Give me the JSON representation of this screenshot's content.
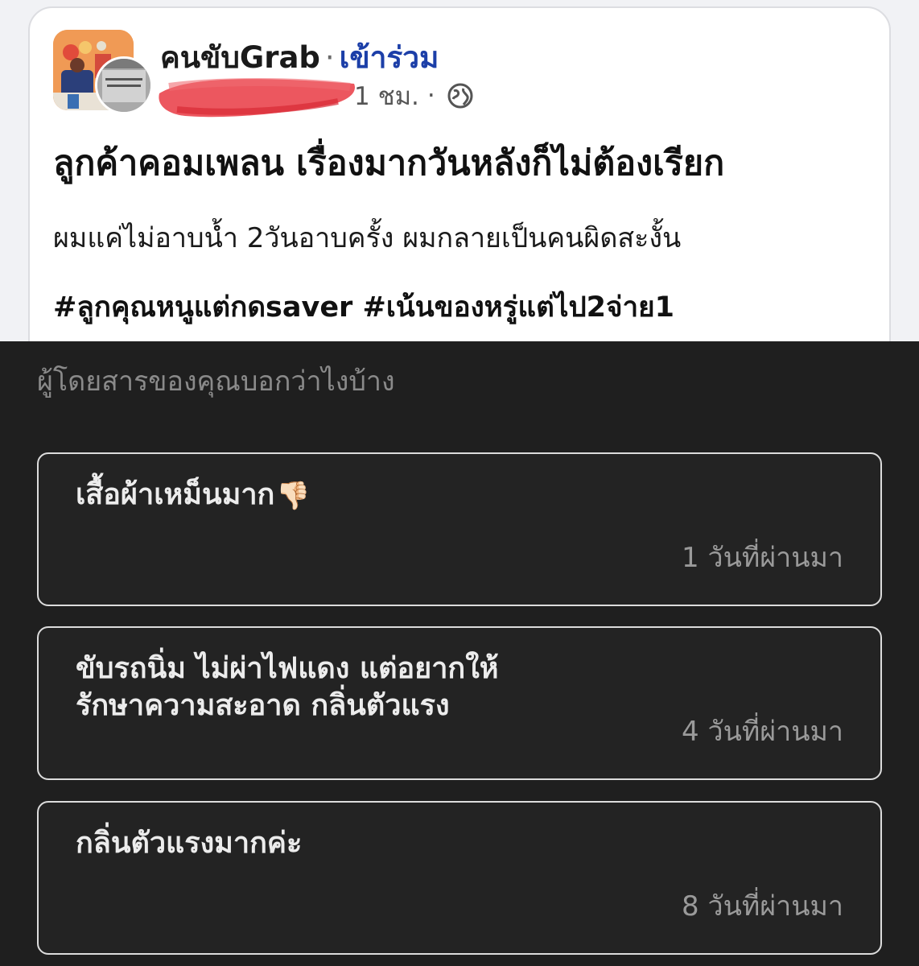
{
  "post": {
    "group_name": "คนขับGrab",
    "separator": "·",
    "join_label": "เข้าร่วม",
    "time": "1 ชม.",
    "meta_separator": "·",
    "privacy_icon": "globe-icon",
    "title": "ลูกค้าคอมเพลน เรื่องมากวันหลังก็ไม่ต้องเรียก",
    "body": "ผมแค่ไม่อาบน้ำ 2วันอาบครั้ง ผมกลายเป็นคนผิดสะงั้น",
    "hashtags": "#ลูกคุณหนูแต่กดsaver #เน้นของหรู่แต่ไป2จ่าย1"
  },
  "feedback": {
    "heading": "ผู้โดยสารของคุณบอกว่าไงบ้าง",
    "items": [
      {
        "text": "เสื้อผ้าเหม็นมาก",
        "emoji": "👎🏻",
        "time": "1 วันที่ผ่านมา"
      },
      {
        "text": "ขับรถนิ่ม ไม่ผ่าไฟแดง  แต่อยากให้\nรักษาความสะอาด กลิ่นตัวแรง",
        "time": "4 วันที่ผ่านมา"
      },
      {
        "text": "กลิ่นตัวแรงมากค่ะ",
        "time": "8 วันที่ผ่านมา"
      }
    ]
  },
  "colors": {
    "join_link": "#1c3fa8",
    "dark_background": "#1f1f1f",
    "card_border": "#dcdcdc",
    "redaction": "#e8323c"
  }
}
